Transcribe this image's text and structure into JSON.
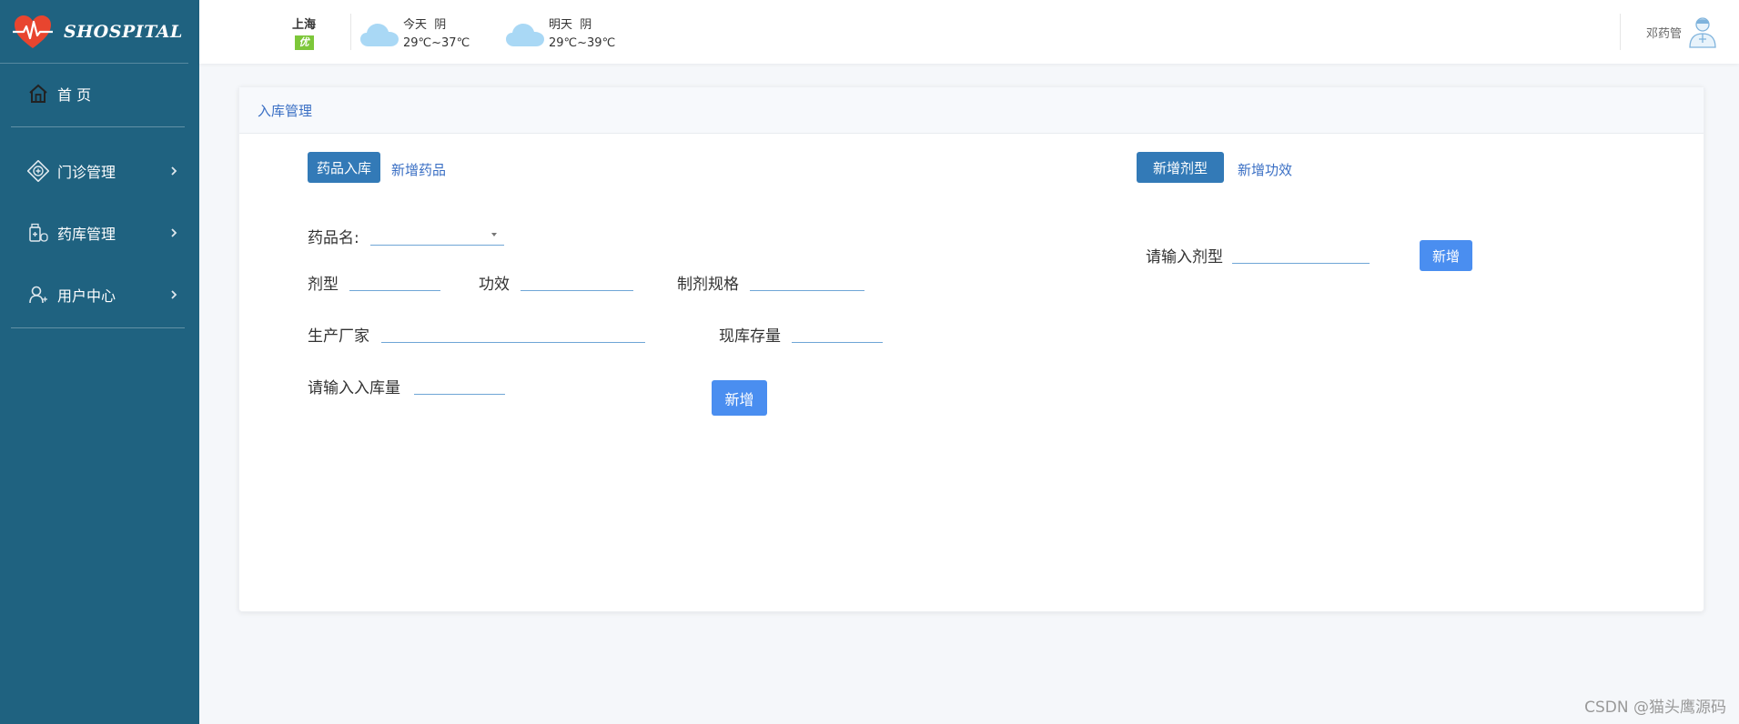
{
  "app": {
    "logo_text": "SHOSPITAL"
  },
  "sidebar": {
    "items": [
      {
        "label": "首 页",
        "icon": "home-icon"
      },
      {
        "label": "门诊管理",
        "icon": "clinic-icon"
      },
      {
        "label": "药库管理",
        "icon": "pharmacy-icon"
      },
      {
        "label": "用户中心",
        "icon": "user-icon"
      }
    ]
  },
  "header": {
    "weather": {
      "city": "上海",
      "aqi": "优",
      "today": {
        "label": "今天",
        "condition": "阴",
        "temp": "29℃~37℃"
      },
      "tomorrow": {
        "label": "明天",
        "condition": "阴",
        "temp": "29℃~39℃"
      }
    },
    "user": {
      "name": "邓药管"
    }
  },
  "card": {
    "title": "入库管理",
    "left": {
      "tab_active": "药品入库",
      "tab_link": "新增药品",
      "drug_name_label": "药品名:",
      "dosage_form_label": "剂型",
      "efficacy_label": "功效",
      "spec_label": "制剂规格",
      "manufacturer_label": "生产厂家",
      "stock_label": "现库存量",
      "quantity_label": "请输入入库量",
      "add_button": "新增"
    },
    "right": {
      "tab_active": "新增剂型",
      "tab_link": "新增功效",
      "form_label": "请输入剂型",
      "add_button": "新增"
    }
  },
  "watermark": "CSDN @猫头鹰源码"
}
